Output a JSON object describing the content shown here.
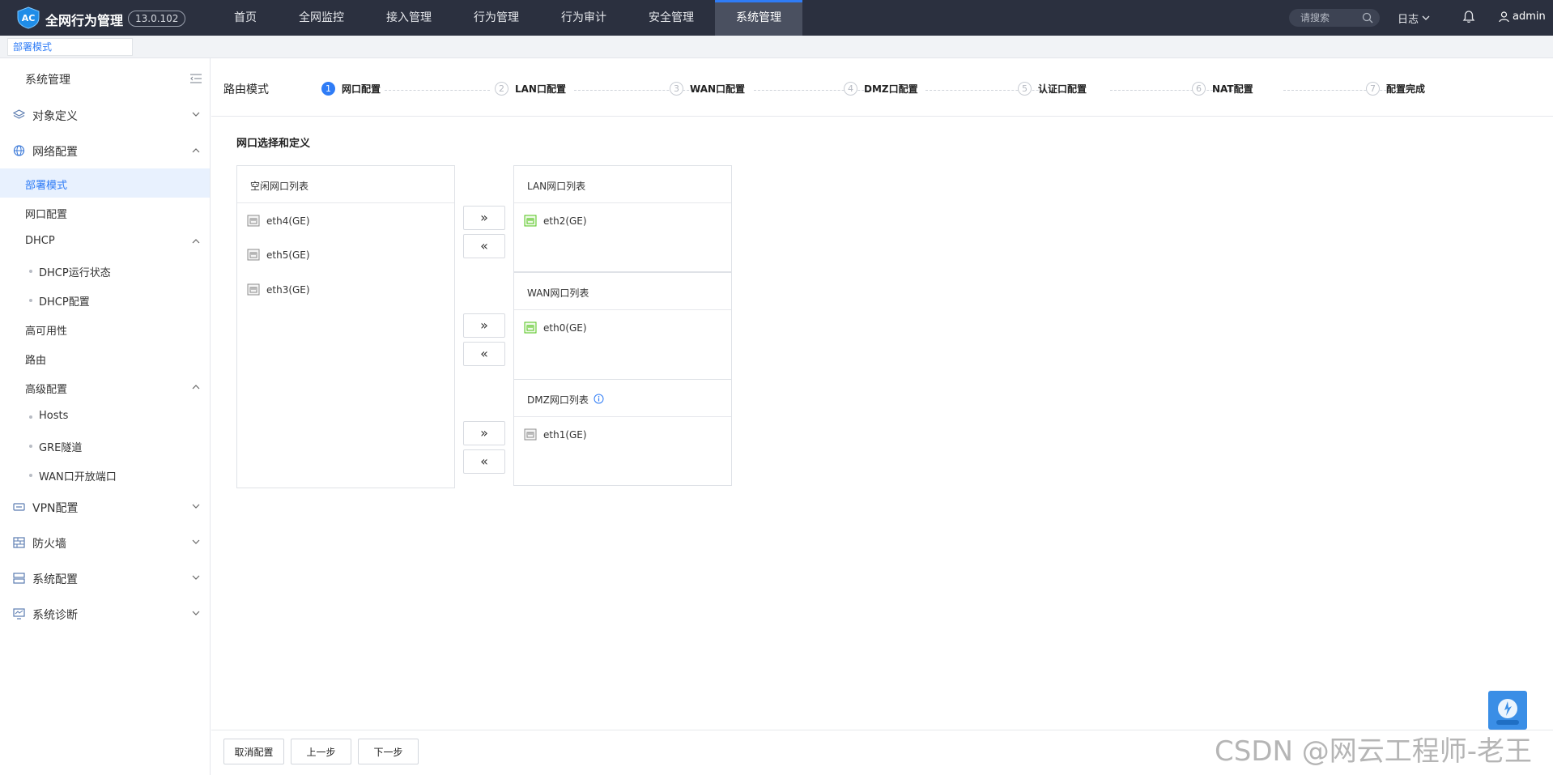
{
  "header": {
    "app_title": "全网行为管理",
    "version": "13.0.102",
    "nav": [
      "首页",
      "全网监控",
      "接入管理",
      "行为管理",
      "行为审计",
      "安全管理",
      "系统管理"
    ],
    "search_placeholder": "请搜索",
    "log_menu": "日志",
    "user": "admin"
  },
  "tabs": [
    "部署模式"
  ],
  "sidebar": {
    "title": "系统管理",
    "groups": {
      "object_def": "对象定义",
      "network": "网络配置",
      "vpn": "VPN配置",
      "firewall": "防火墙",
      "sys_config": "系统配置",
      "sys_diag": "系统诊断"
    },
    "network_items": {
      "deploy_mode": "部署模式",
      "port_config": "网口配置",
      "dhcp": "DHCP",
      "dhcp_status": "DHCP运行状态",
      "dhcp_config": "DHCP配置",
      "ha": "高可用性",
      "route": "路由",
      "advanced": "高级配置",
      "hosts": "Hosts",
      "gre": "GRE隧道",
      "wan_ports": "WAN口开放端口"
    }
  },
  "wizard": {
    "mode": "路由模式",
    "steps": [
      {
        "num": "1",
        "label": "网口配置"
      },
      {
        "num": "2",
        "label": "LAN口配置"
      },
      {
        "num": "3",
        "label": "WAN口配置"
      },
      {
        "num": "4",
        "label": "DMZ口配置"
      },
      {
        "num": "5",
        "label": "认证口配置"
      },
      {
        "num": "6",
        "label": "NAT配置"
      },
      {
        "num": "7",
        "label": "配置完成"
      }
    ],
    "active_step": 1
  },
  "section_title": "网口选择和定义",
  "idle_list": {
    "title": "空闲网口列表",
    "ports": [
      "eth4(GE)",
      "eth5(GE)",
      "eth3(GE)"
    ]
  },
  "lan_list": {
    "title": "LAN网口列表",
    "ports": [
      "eth2(GE)"
    ]
  },
  "wan_list": {
    "title": "WAN网口列表",
    "ports": [
      "eth0(GE)"
    ]
  },
  "dmz_list": {
    "title": "DMZ网口列表",
    "ports": [
      "eth1(GE)"
    ]
  },
  "move_buttons": {
    "right": "»",
    "left": "«"
  },
  "footer": {
    "cancel": "取消配置",
    "prev": "上一步",
    "next": "下一步"
  },
  "watermark": "CSDN @网云工程师-老王",
  "colors": {
    "accent": "#2f7cf6",
    "topbar": "#2b303f",
    "port_active": "#52c41a",
    "port_idle": "#8c8c8c"
  }
}
